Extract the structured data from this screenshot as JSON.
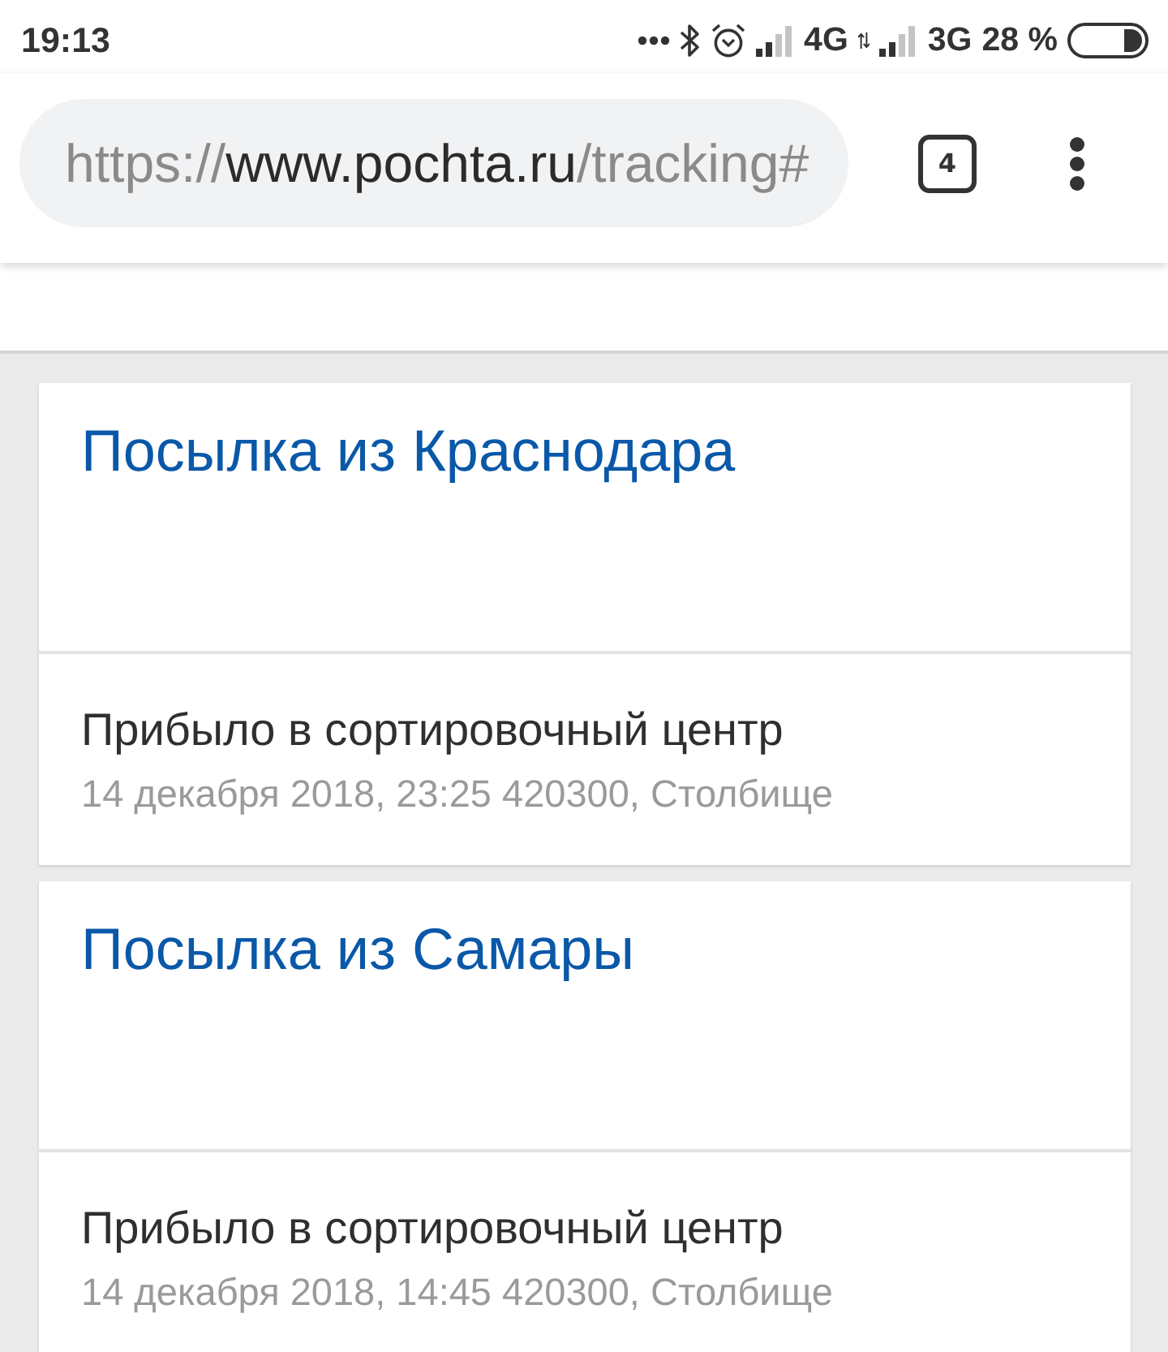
{
  "status_bar": {
    "time": "19:13",
    "network_1": "4G",
    "network_2": "3G",
    "battery": "28 %"
  },
  "browser": {
    "url": {
      "scheme": "https://",
      "host": "www.pochta.ru",
      "path": "/tracking#"
    },
    "tab_count": "4"
  },
  "parcels": [
    {
      "title": "Посылка из Краснодара",
      "status": "Прибыло в сортировочный центр",
      "details": "14 декабря 2018, 23:25 420300, Столбище"
    },
    {
      "title": "Посылка из Самары",
      "status": "Прибыло в сортировочный центр",
      "details": "14 декабря 2018, 14:45 420300, Столбище"
    }
  ]
}
